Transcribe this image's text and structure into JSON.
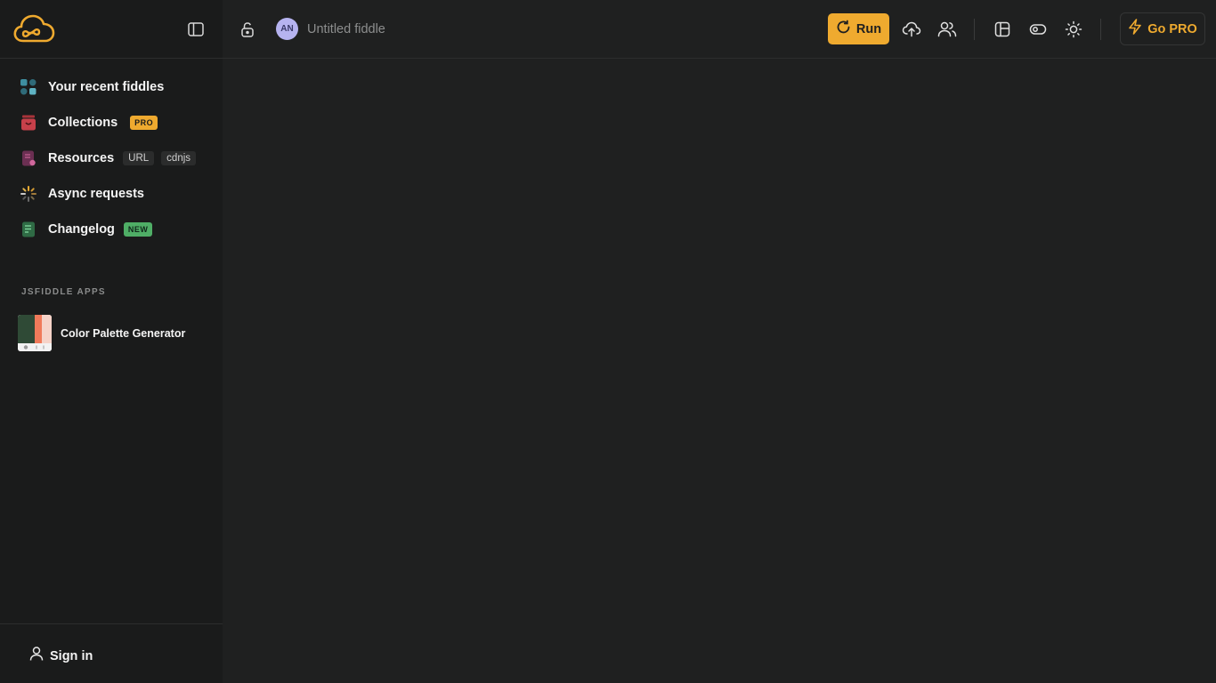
{
  "sidebar": {
    "nav": [
      {
        "label": "Your recent fiddles",
        "icon": "grid-icon"
      },
      {
        "label": "Collections",
        "icon": "collections-icon",
        "badge": "PRO"
      },
      {
        "label": "Resources",
        "icon": "resources-icon",
        "chips": [
          "URL",
          "cdnjs"
        ]
      },
      {
        "label": "Async requests",
        "icon": "spinner-icon"
      },
      {
        "label": "Changelog",
        "icon": "changelog-icon",
        "badge": "NEW"
      }
    ],
    "apps_heading": "JSFIDDLE APPS",
    "apps": [
      {
        "label": "Color Palette Generator",
        "icon": "palette-thumbnail"
      }
    ],
    "sign_in": "Sign in"
  },
  "topbar": {
    "avatar_initials": "AN",
    "title_placeholder": "Untitled fiddle",
    "run_label": "Run",
    "go_pro_label": "Go PRO"
  },
  "colors": {
    "accent": "#efaa2f",
    "background": "#1f2020",
    "sidebar": "#1a1b1b",
    "new_badge": "#4fae66",
    "avatar": "#b6b3f0"
  }
}
